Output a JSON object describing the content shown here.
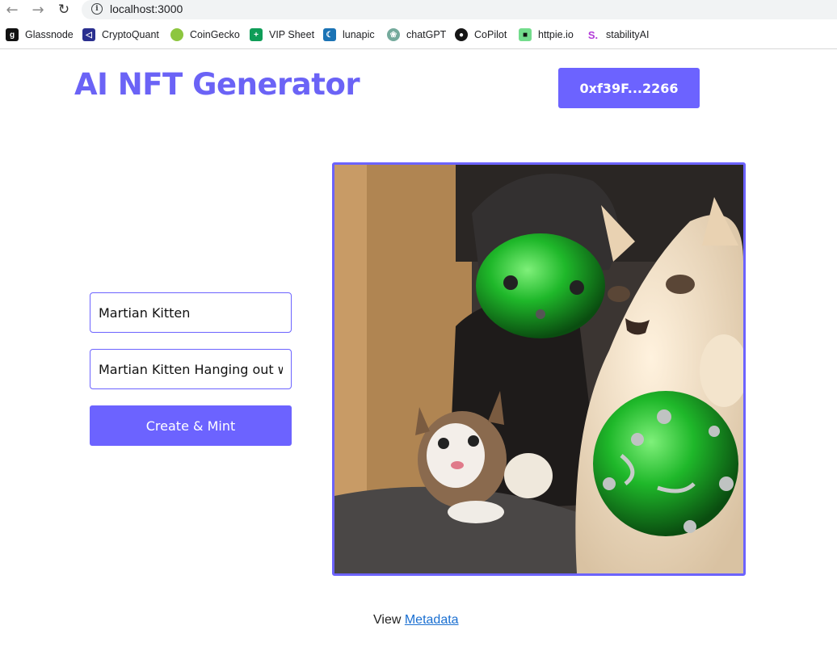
{
  "browser": {
    "url": "localhost:3000",
    "bookmarks": [
      {
        "label": "Glassnode",
        "icon": "glassnode-icon",
        "color": "#111111",
        "glyph": "g"
      },
      {
        "label": "CryptoQuant",
        "icon": "cryptoquant-icon",
        "color": "#2a2f8f",
        "glyph": "C"
      },
      {
        "label": "CoinGecko",
        "icon": "coingecko-icon",
        "color": "#8dc63f",
        "glyph": ""
      },
      {
        "label": "VIP Sheet",
        "icon": "sheets-icon",
        "color": "#0f9d58",
        "glyph": "+"
      },
      {
        "label": "lunapic",
        "icon": "lunapic-icon",
        "color": "#1b73b5",
        "glyph": ""
      },
      {
        "label": "chatGPT",
        "icon": "chatgpt-icon",
        "color": "#74aa9c",
        "glyph": ""
      },
      {
        "label": "CoPilot",
        "icon": "github-icon",
        "color": "#161616",
        "glyph": ""
      },
      {
        "label": "httpie.io",
        "icon": "httpie-icon",
        "color": "#73dc8c",
        "glyph": ""
      },
      {
        "label": "stabilityAI",
        "icon": "stability-icon",
        "color": "#ffffff",
        "glyph": "S."
      }
    ]
  },
  "app": {
    "title": "AI NFT Generator",
    "account": "0xf39F...2266",
    "name_value": "Martian Kitten",
    "description_value": "Martian Kitten Hanging out with friends",
    "submit_label": "Create & Mint",
    "view_text": "View",
    "metadata_link": "Metadata",
    "accent_color": "#6c63ff"
  }
}
